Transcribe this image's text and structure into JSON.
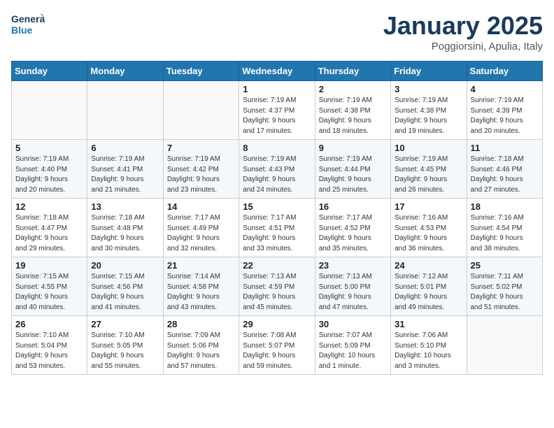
{
  "header": {
    "logo_general": "General",
    "logo_blue": "Blue",
    "month_title": "January 2025",
    "location": "Poggiorsini, Apulia, Italy"
  },
  "days_of_week": [
    "Sunday",
    "Monday",
    "Tuesday",
    "Wednesday",
    "Thursday",
    "Friday",
    "Saturday"
  ],
  "weeks": [
    [
      {
        "day": "",
        "info": ""
      },
      {
        "day": "",
        "info": ""
      },
      {
        "day": "",
        "info": ""
      },
      {
        "day": "1",
        "info": "Sunrise: 7:19 AM\nSunset: 4:37 PM\nDaylight: 9 hours\nand 17 minutes."
      },
      {
        "day": "2",
        "info": "Sunrise: 7:19 AM\nSunset: 4:38 PM\nDaylight: 9 hours\nand 18 minutes."
      },
      {
        "day": "3",
        "info": "Sunrise: 7:19 AM\nSunset: 4:38 PM\nDaylight: 9 hours\nand 19 minutes."
      },
      {
        "day": "4",
        "info": "Sunrise: 7:19 AM\nSunset: 4:39 PM\nDaylight: 9 hours\nand 20 minutes."
      }
    ],
    [
      {
        "day": "5",
        "info": "Sunrise: 7:19 AM\nSunset: 4:40 PM\nDaylight: 9 hours\nand 20 minutes."
      },
      {
        "day": "6",
        "info": "Sunrise: 7:19 AM\nSunset: 4:41 PM\nDaylight: 9 hours\nand 21 minutes."
      },
      {
        "day": "7",
        "info": "Sunrise: 7:19 AM\nSunset: 4:42 PM\nDaylight: 9 hours\nand 23 minutes."
      },
      {
        "day": "8",
        "info": "Sunrise: 7:19 AM\nSunset: 4:43 PM\nDaylight: 9 hours\nand 24 minutes."
      },
      {
        "day": "9",
        "info": "Sunrise: 7:19 AM\nSunset: 4:44 PM\nDaylight: 9 hours\nand 25 minutes."
      },
      {
        "day": "10",
        "info": "Sunrise: 7:19 AM\nSunset: 4:45 PM\nDaylight: 9 hours\nand 26 minutes."
      },
      {
        "day": "11",
        "info": "Sunrise: 7:18 AM\nSunset: 4:46 PM\nDaylight: 9 hours\nand 27 minutes."
      }
    ],
    [
      {
        "day": "12",
        "info": "Sunrise: 7:18 AM\nSunset: 4:47 PM\nDaylight: 9 hours\nand 29 minutes."
      },
      {
        "day": "13",
        "info": "Sunrise: 7:18 AM\nSunset: 4:48 PM\nDaylight: 9 hours\nand 30 minutes."
      },
      {
        "day": "14",
        "info": "Sunrise: 7:17 AM\nSunset: 4:49 PM\nDaylight: 9 hours\nand 32 minutes."
      },
      {
        "day": "15",
        "info": "Sunrise: 7:17 AM\nSunset: 4:51 PM\nDaylight: 9 hours\nand 33 minutes."
      },
      {
        "day": "16",
        "info": "Sunrise: 7:17 AM\nSunset: 4:52 PM\nDaylight: 9 hours\nand 35 minutes."
      },
      {
        "day": "17",
        "info": "Sunrise: 7:16 AM\nSunset: 4:53 PM\nDaylight: 9 hours\nand 36 minutes."
      },
      {
        "day": "18",
        "info": "Sunrise: 7:16 AM\nSunset: 4:54 PM\nDaylight: 9 hours\nand 38 minutes."
      }
    ],
    [
      {
        "day": "19",
        "info": "Sunrise: 7:15 AM\nSunset: 4:55 PM\nDaylight: 9 hours\nand 40 minutes."
      },
      {
        "day": "20",
        "info": "Sunrise: 7:15 AM\nSunset: 4:56 PM\nDaylight: 9 hours\nand 41 minutes."
      },
      {
        "day": "21",
        "info": "Sunrise: 7:14 AM\nSunset: 4:58 PM\nDaylight: 9 hours\nand 43 minutes."
      },
      {
        "day": "22",
        "info": "Sunrise: 7:13 AM\nSunset: 4:59 PM\nDaylight: 9 hours\nand 45 minutes."
      },
      {
        "day": "23",
        "info": "Sunrise: 7:13 AM\nSunset: 5:00 PM\nDaylight: 9 hours\nand 47 minutes."
      },
      {
        "day": "24",
        "info": "Sunrise: 7:12 AM\nSunset: 5:01 PM\nDaylight: 9 hours\nand 49 minutes."
      },
      {
        "day": "25",
        "info": "Sunrise: 7:11 AM\nSunset: 5:02 PM\nDaylight: 9 hours\nand 51 minutes."
      }
    ],
    [
      {
        "day": "26",
        "info": "Sunrise: 7:10 AM\nSunset: 5:04 PM\nDaylight: 9 hours\nand 53 minutes."
      },
      {
        "day": "27",
        "info": "Sunrise: 7:10 AM\nSunset: 5:05 PM\nDaylight: 9 hours\nand 55 minutes."
      },
      {
        "day": "28",
        "info": "Sunrise: 7:09 AM\nSunset: 5:06 PM\nDaylight: 9 hours\nand 57 minutes."
      },
      {
        "day": "29",
        "info": "Sunrise: 7:08 AM\nSunset: 5:07 PM\nDaylight: 9 hours\nand 59 minutes."
      },
      {
        "day": "30",
        "info": "Sunrise: 7:07 AM\nSunset: 5:09 PM\nDaylight: 10 hours\nand 1 minute."
      },
      {
        "day": "31",
        "info": "Sunrise: 7:06 AM\nSunset: 5:10 PM\nDaylight: 10 hours\nand 3 minutes."
      },
      {
        "day": "",
        "info": ""
      }
    ]
  ]
}
